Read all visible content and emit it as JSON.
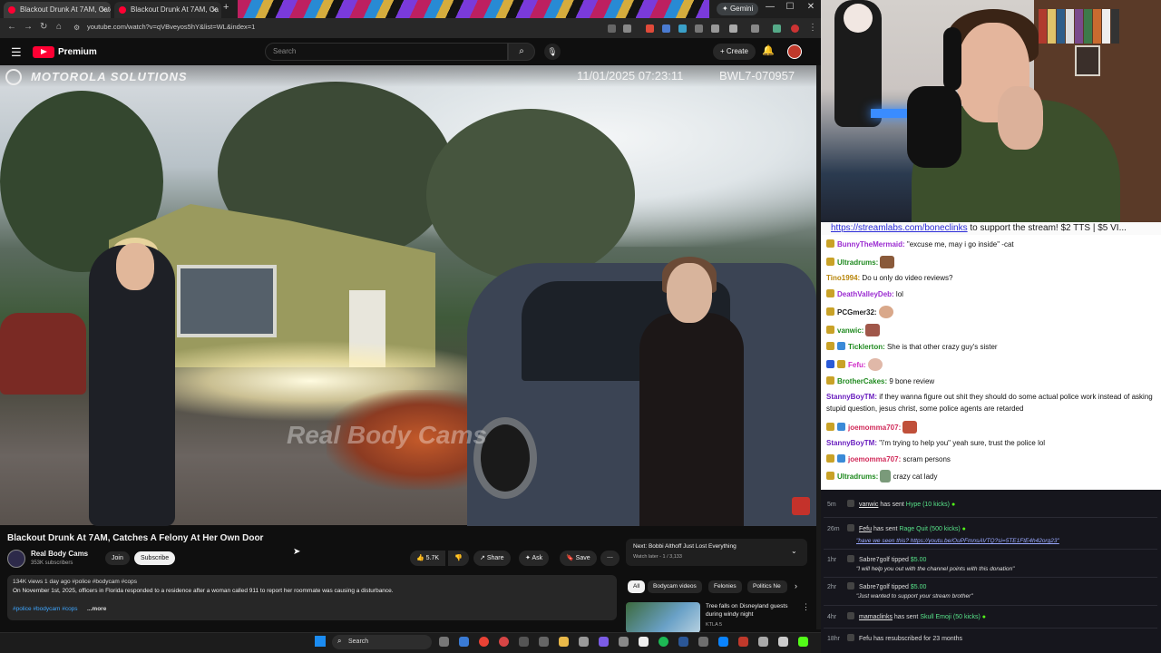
{
  "browser": {
    "tabs": [
      {
        "label": "Blackout Drunk At 7AM, Catch"
      },
      {
        "label": "Blackout Drunk At 7AM, Ca"
      }
    ],
    "gemini": "Gemini",
    "url": "youtube.com/watch?v=qVBveyos5hY&list=WL&index=1"
  },
  "youtube": {
    "brand": "Premium",
    "search_placeholder": "Search",
    "create": "Create"
  },
  "video": {
    "overlay_brand": "MOTOROLA SOLUTIONS",
    "timestamp": "11/01/2025 07:23:11",
    "camera_id": "BWL7-070957",
    "watermark": "Real Body Cams",
    "title": "Blackout Drunk At 7AM, Catches A Felony At Her Own Door",
    "channel": "Real Body Cams",
    "subscribers": "353K subscribers",
    "join": "Join",
    "subscribe": "Subscribe",
    "likes": "5.7K",
    "share": "Share",
    "ask": "Ask",
    "save": "Save",
    "views_meta": "134K views  1 day ago  #police #bodycam #cops",
    "description": "On November 1st, 2025, officers in Florida responded to a residence after a woman called 911 to report her roommate was causing a disturbance.",
    "tags": "#police #bodycam #cops",
    "more": "...more"
  },
  "playlist": {
    "next": "Next: Bobbi Althoff Just Lost Everything",
    "sub": "Watch later - 1 / 3,133"
  },
  "chips": [
    "All",
    "Bodycam videos",
    "Felonies",
    "Politics Ne"
  ],
  "related": {
    "title": "Tree falls on Disneyland guests during windy night",
    "channel": "KTLA 5"
  },
  "taskbar": {
    "search": "Search"
  },
  "chat": {
    "banner_link": "https://streamlabs.com/boneclinks",
    "banner_text": " to support the stream! $2 TTS | $5 VI...",
    "messages": [
      {
        "user": "BunnyTheMermaid:",
        "text": " \"excuse me, may i go inside\" -cat",
        "color": "#9b2bd1"
      },
      {
        "user": "Ultradrums:",
        "text": "",
        "color": "#1f8a1f",
        "emote": true
      },
      {
        "user": "Tino1994:",
        "text": " Do u only do video reviews?",
        "color": "#b8860b"
      },
      {
        "user": "DeathValleyDeb:",
        "text": " lol",
        "color": "#9b2bd1"
      },
      {
        "user": "PCGmer32:",
        "text": "",
        "color": "#1f1f1f",
        "emote": true
      },
      {
        "user": "vanwic:",
        "text": "",
        "color": "#1f8a1f",
        "emote": true
      },
      {
        "user": "Ticklerton:",
        "text": " She is that other crazy guy's sister",
        "color": "#1f8a1f"
      },
      {
        "user": "Fefu:",
        "text": "",
        "color": "#d12bc7",
        "emote": true
      },
      {
        "user": "BrotherCakes:",
        "text": " 9 bone review",
        "color": "#1f8a1f"
      },
      {
        "user": "StannyBoyTM:",
        "text": " if they wanna figure out shit they should do some actual police work instead of asking stupid question, jesus christ, some police agents are retarded",
        "color": "#6a1fbf"
      },
      {
        "user": "joemomma707:",
        "text": "",
        "color": "#d12b5a",
        "emote": true
      },
      {
        "user": "StannyBoyTM:",
        "text": " \"i'm trying to help you\" yeah sure, trust the police lol",
        "color": "#6a1fbf"
      },
      {
        "user": "joemomma707:",
        "text": " scram persons",
        "color": "#d12b5a"
      },
      {
        "user": "Ultradrums:",
        "text": " crazy cat lady",
        "color": "#1f8a1f",
        "emote": true
      }
    ]
  },
  "feed": [
    {
      "time": "5m",
      "name": "vanwic",
      "action": "has sent",
      "highlight": "Hype (10 kicks)"
    },
    {
      "time": "26m",
      "name": "Fefu",
      "action": "has sent",
      "highlight": "Rage Quit (500 kicks)",
      "sub": "\"have we seen this? https://youtu.be/OuPFmnsAVTQ?si=5TE1FtE4h42org23\""
    },
    {
      "time": "1hr",
      "name": "Sabre7golf",
      "action": "tipped",
      "highlight": "$5.00",
      "sub": "\"I will help you out with the channel points with this donation\""
    },
    {
      "time": "2hr",
      "name": "Sabre7golf",
      "action": "tipped",
      "highlight": "$5.00",
      "sub": "\"Just wanted to support your stream brother\""
    },
    {
      "time": "4hr",
      "name": "mamaclinks",
      "action": "has sent",
      "highlight": "Skull Emoji (50 kicks)"
    },
    {
      "time": "18hr",
      "name": "Fefu",
      "action": "has resubscribed for 23 months",
      "highlight": ""
    }
  ]
}
